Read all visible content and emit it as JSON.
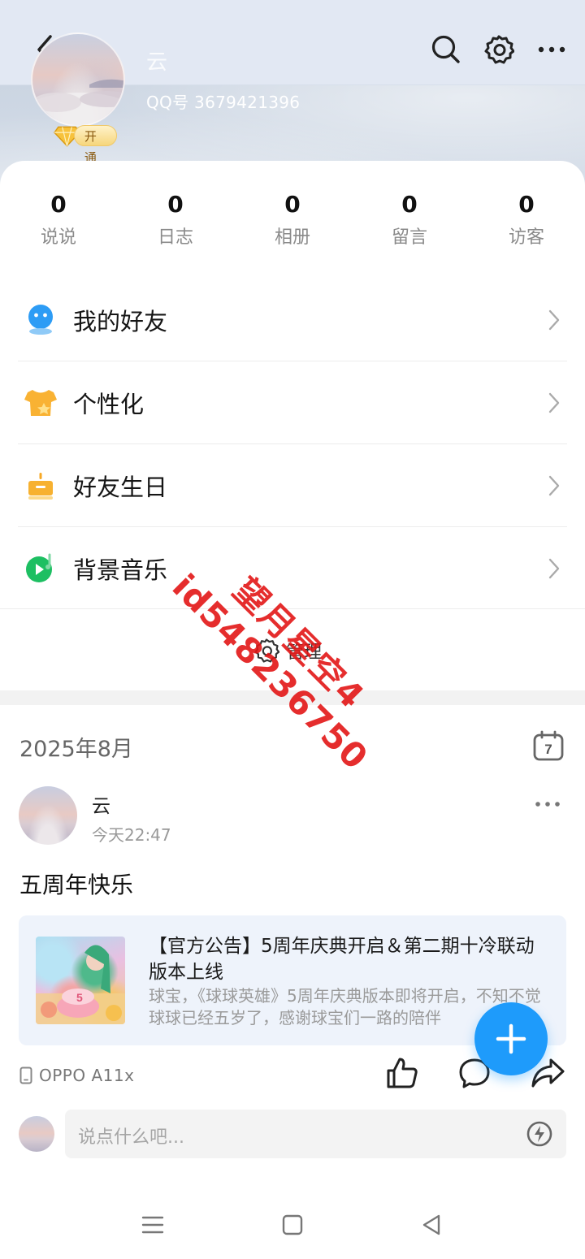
{
  "profile": {
    "name": "云",
    "qq_number": "QQ号 3679421396",
    "vip_label": "开通"
  },
  "stats": [
    {
      "value": "0",
      "label": "说说"
    },
    {
      "value": "0",
      "label": "日志"
    },
    {
      "value": "0",
      "label": "相册"
    },
    {
      "value": "0",
      "label": "留言"
    },
    {
      "value": "0",
      "label": "访客"
    }
  ],
  "menu": [
    {
      "label": "我的好友",
      "icon": "friends-icon"
    },
    {
      "label": "个性化",
      "icon": "personalize-icon"
    },
    {
      "label": "好友生日",
      "icon": "birthday-icon"
    },
    {
      "label": "背景音乐",
      "icon": "music-icon"
    }
  ],
  "manage_label": "管理",
  "feed": {
    "month": "2025年8月",
    "calendar_day": "7",
    "post": {
      "author": "云",
      "time": "今天22:47",
      "text": "五周年快乐",
      "share": {
        "title": "【官方公告】5周年庆典开启＆第二期十冷联动版本上线",
        "desc": "球宝，《球球英雄》5周年庆典版本即将开启，不知不觉球球已经五岁了，感谢球宝们一路的陪伴"
      },
      "device": "OPPO A11x"
    },
    "comment_placeholder": "说点什么吧..."
  },
  "watermark": {
    "line1": "望月星空4",
    "line2": "id548236750"
  },
  "colors": {
    "accent": "#1e9bfb",
    "watermark": "#e21616"
  }
}
